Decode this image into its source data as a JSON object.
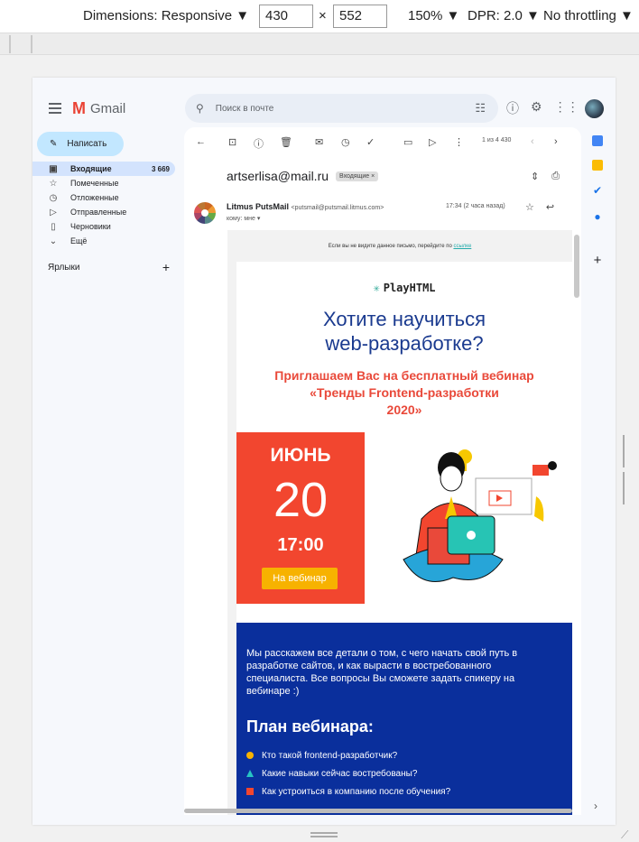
{
  "devtools": {
    "dimensions_label": "Dimensions: Responsive",
    "width": "430",
    "height": "552",
    "times": "×",
    "zoom": "150%",
    "dpr": "DPR: 2.0",
    "throttle": "No throttling",
    "caret": "▼"
  },
  "gmail": {
    "logo_text": "Gmail",
    "logo_letter": "M",
    "compose": "Написать",
    "nav": [
      {
        "label": "Входящие",
        "count": "3 669",
        "icon": "inbox-icon",
        "glyph": "▣"
      },
      {
        "label": "Помеченные",
        "count": "",
        "icon": "star-icon",
        "glyph": "☆"
      },
      {
        "label": "Отложенные",
        "count": "",
        "icon": "clock-icon",
        "glyph": "◷"
      },
      {
        "label": "Отправленные",
        "count": "",
        "icon": "send-icon",
        "glyph": "▷"
      },
      {
        "label": "Черновики",
        "count": "",
        "icon": "draft-icon",
        "glyph": "▯"
      },
      {
        "label": "Ещё",
        "count": "",
        "icon": "chevron-down-icon",
        "glyph": "⌄"
      }
    ],
    "labels_title": "Ярлыки",
    "search_placeholder": "Поиск в почте"
  },
  "message": {
    "pager": "1 из 4 430",
    "subject": "artserlisa@mail.ru",
    "tag": "Входящие ×",
    "sender_name": "Litmus PutsMail",
    "sender_addr": "<putsmail@putsmail.litmus.com>",
    "to": "кому: мне ▾",
    "time": "17:34 (2 часа назад)"
  },
  "email": {
    "notice_text": "Если вы не видите данное письмо, перейдите по ",
    "notice_link": "ссылке",
    "brand": "PlayHTML",
    "headline_1": "Хотите научиться",
    "headline_2": "web-разработке?",
    "invite_1": "Приглашаем Вас на бесплатный вебинар",
    "invite_2": "«Тренды Frontend-разработки",
    "invite_3": "2020»",
    "month": "ИЮНЬ",
    "day": "20",
    "hour": "17:00",
    "cta": "На вебинар",
    "paragraph": "Мы расскажем все детали о том, с чего начать свой путь в разработке сайтов, и как вырасти в востребованного специалиста. Все вопросы Вы сможете задать спикеру на вебинаре :)",
    "plan_title": "План вебинара:",
    "plan": [
      {
        "text": "Кто такой frontend-разработчик?",
        "color": "#f7b200",
        "shape": "circle"
      },
      {
        "text": "Какие навыки сейчас востребованы?",
        "color": "#27c4c4",
        "shape": "triangle"
      },
      {
        "text": "Как устроиться в компанию после обучения?",
        "color": "#f2462f",
        "shape": "square"
      }
    ]
  }
}
